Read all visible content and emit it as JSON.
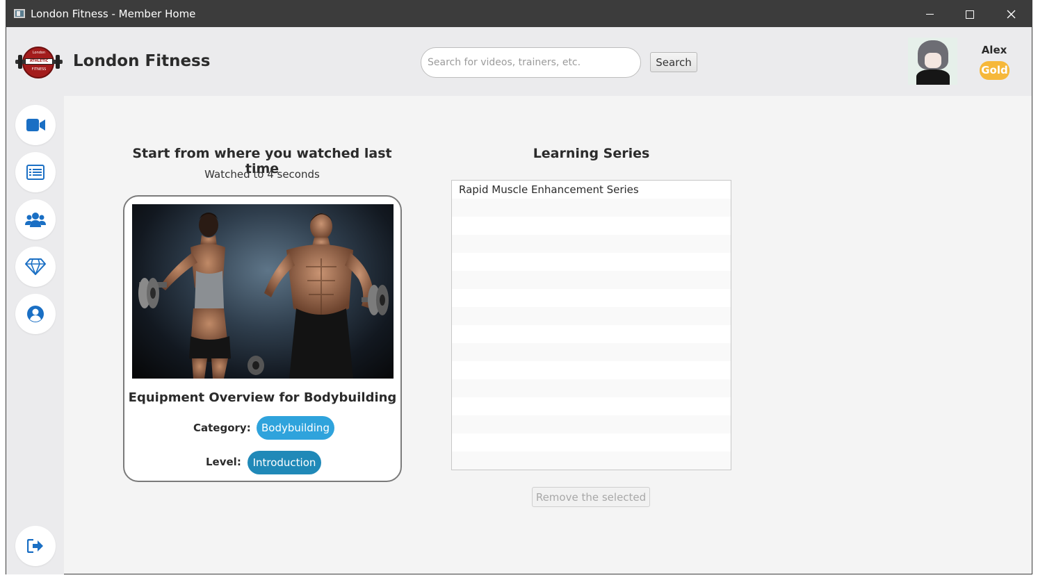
{
  "window": {
    "title": "London Fitness - Member Home",
    "controls": {
      "minimize_icon": "minimize-icon",
      "maximize_icon": "maximize-icon",
      "close_icon": "close-icon"
    }
  },
  "header": {
    "logo": {
      "top_text": "London",
      "band_text": "ATHLETIC",
      "bottom_text": "FITNESS"
    },
    "brand": "London Fitness",
    "search": {
      "placeholder": "Search for videos, trainers, etc.",
      "value": "",
      "button_label": "Search"
    },
    "user": {
      "name": "Alex",
      "tier": "Gold"
    }
  },
  "sidebar": {
    "items": [
      {
        "name": "videos",
        "icon": "video-camera-icon"
      },
      {
        "name": "list",
        "icon": "list-icon"
      },
      {
        "name": "trainers",
        "icon": "users-icon"
      },
      {
        "name": "membership",
        "icon": "diamond-icon"
      },
      {
        "name": "profile",
        "icon": "user-circle-icon"
      }
    ],
    "logout_icon": "logout-icon"
  },
  "continue_watching": {
    "heading": "Start from where you watched last time",
    "progress": "Watched to 4 seconds",
    "video": {
      "title": "Equipment Overview for Bodybuilding",
      "category_label": "Category:",
      "category": "Bodybuilding",
      "level_label": "Level:",
      "level": "Introduction"
    }
  },
  "learning_series": {
    "heading": "Learning Series",
    "items": [
      "Rapid Muscle Enhancement Series",
      "",
      "",
      "",
      "",
      "",
      "",
      "",
      "",
      "",
      "",
      "",
      "",
      "",
      "",
      ""
    ],
    "remove_label": "Remove the selected"
  },
  "colors": {
    "titlebar": "#3c3c3c",
    "category_pill": "#2fa3dc",
    "level_pill": "#2089b8",
    "tier_badge": "#f6b83a",
    "nav_icon": "#1a6fc4"
  }
}
